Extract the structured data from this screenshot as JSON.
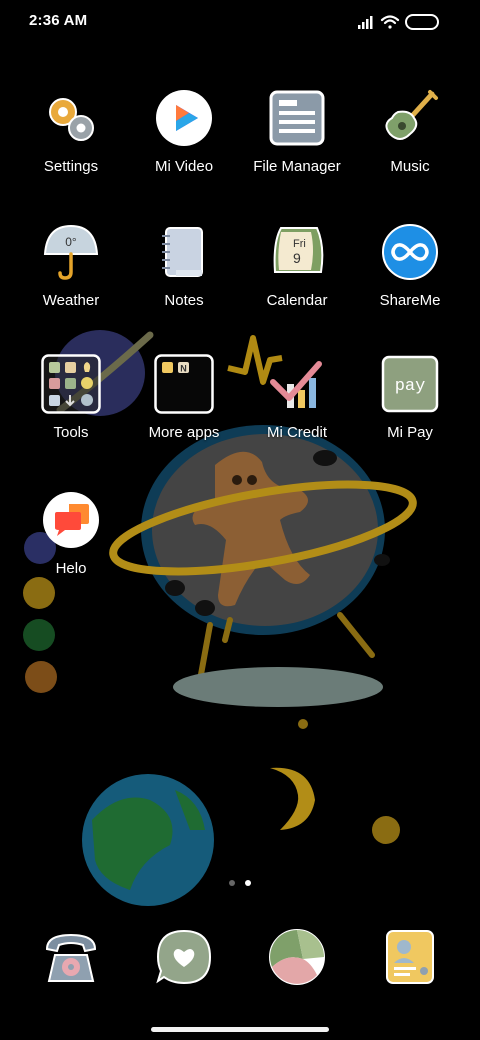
{
  "status_bar": {
    "time": "2:36 AM"
  },
  "apps": [
    {
      "id": "settings",
      "label": "Settings",
      "icon": "settings-gears-icon"
    },
    {
      "id": "mi-video",
      "label": "Mi Video",
      "icon": "play-triangle-icon"
    },
    {
      "id": "file-manager",
      "label": "File Manager",
      "icon": "file-list-icon"
    },
    {
      "id": "music",
      "label": "Music",
      "icon": "guitar-icon"
    },
    {
      "id": "weather",
      "label": "Weather",
      "icon": "umbrella-icon",
      "temperature": "0°"
    },
    {
      "id": "notes",
      "label": "Notes",
      "icon": "notebook-icon"
    },
    {
      "id": "calendar",
      "label": "Calendar",
      "icon": "calendar-icon",
      "day_name": "Fri",
      "day_number": "9"
    },
    {
      "id": "shareme",
      "label": "ShareMe",
      "icon": "infinity-icon"
    },
    {
      "id": "tools",
      "label": "Tools",
      "icon": "folder-icon"
    },
    {
      "id": "more-apps",
      "label": "More apps",
      "icon": "folder-icon",
      "letter": "N"
    },
    {
      "id": "mi-credit",
      "label": "Mi Credit",
      "icon": "check-chart-icon"
    },
    {
      "id": "mi-pay",
      "label": "Mi Pay",
      "icon": "pay-icon",
      "icon_text": "pay"
    },
    {
      "id": "helo",
      "label": "Helo",
      "icon": "chat-bubbles-icon"
    }
  ],
  "dock": [
    {
      "id": "phone",
      "icon": "telephone-icon"
    },
    {
      "id": "messages",
      "icon": "heart-message-icon"
    },
    {
      "id": "browser",
      "icon": "browser-icon"
    },
    {
      "id": "contacts",
      "icon": "contacts-card-icon"
    }
  ],
  "pager": {
    "page_count": 2,
    "active_page": 2
  },
  "colors": {
    "background": "#000000",
    "mi_video_purple": "#6a4cf0",
    "shareme_blue": "#1e8fe5",
    "helo_orange": "#ff5a36",
    "mi_pay_green": "#8ea07f"
  }
}
